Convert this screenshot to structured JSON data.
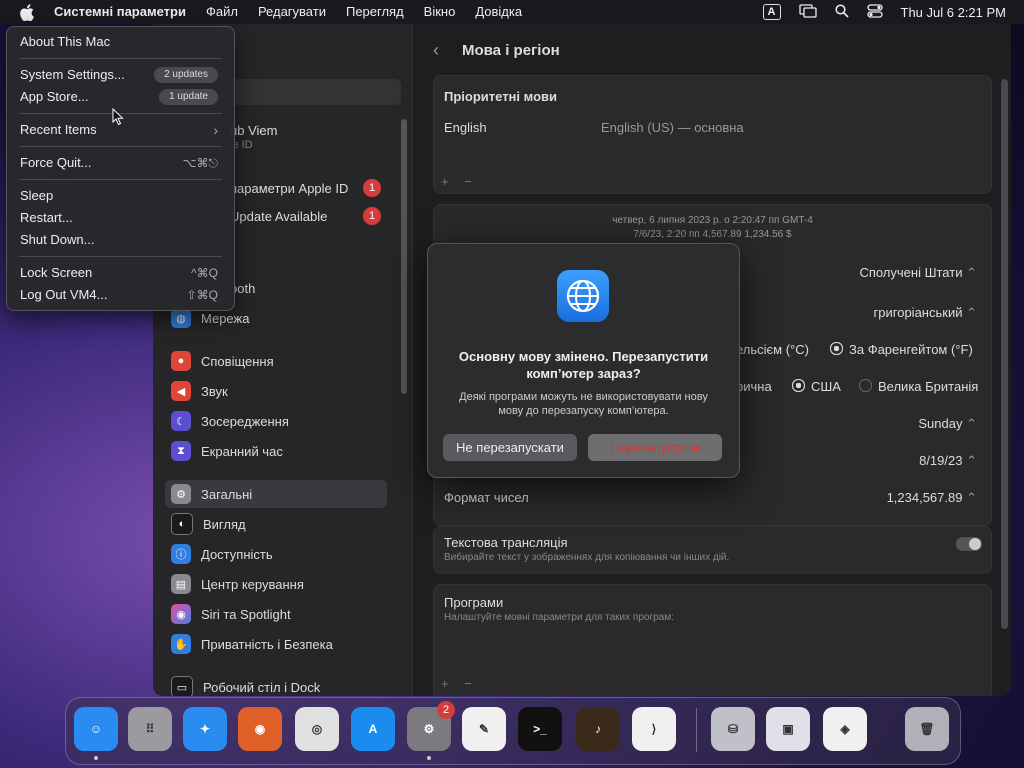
{
  "menubar": {
    "app_name": "Системні параметри",
    "menus": [
      "Файл",
      "Редагувати",
      "Перегляд",
      "Вікно",
      "Довідка"
    ],
    "input_badge": "A",
    "clock": "Thu Jul 6  2:21 PM"
  },
  "apple_menu": {
    "about": "About This Mac",
    "system_settings": "System Settings...",
    "system_settings_badge": "2 updates",
    "app_store": "App Store...",
    "app_store_badge": "1 update",
    "recent_items": "Recent Items",
    "force_quit": "Force Quit...",
    "force_quit_shortcut": "⌥⌘⎋",
    "sleep": "Sleep",
    "restart": "Restart...",
    "shut_down": "Shut Down...",
    "lock_screen": "Lock Screen",
    "lock_screen_shortcut": "^⌘Q",
    "log_out": "Log Out VM4...",
    "log_out_shortcut": "⇧⌘Q"
  },
  "sidebar": {
    "profile_name_partial": "ub Viem",
    "profile_sub_partial": "le ID",
    "apple_id_partial": "параметри Apple ID",
    "apple_id_badge": "1",
    "update_partial": "Update Available",
    "update_badge": "1",
    "bluetooth_partial": "ooth",
    "items": [
      {
        "label": "Мережа",
        "color": "#2f7ee0"
      },
      {
        "label": "Сповіщення",
        "color": "#e0453a"
      },
      {
        "label": "Звук",
        "color": "#e0453a"
      },
      {
        "label": "Зосередження",
        "color": "#5b4fd0"
      },
      {
        "label": "Екранний час",
        "color": "#5b4fd0"
      },
      {
        "label": "Загальні",
        "color": "#8a8a8e"
      },
      {
        "label": "Вигляд",
        "color": "#1a1a1a"
      },
      {
        "label": "Доступність",
        "color": "#2f7ee0"
      },
      {
        "label": "Центр керування",
        "color": "#8a8a8e"
      },
      {
        "label": "Siri та Spotlight",
        "color": "#b04fd0"
      },
      {
        "label": "Приватність і Безпека",
        "color": "#2f7ee0"
      },
      {
        "label": "Робочий стіл і Dock",
        "color": "#1a1a1a"
      }
    ]
  },
  "main": {
    "title": "Мова і регіон",
    "preferred_title": "Пріоритетні мови",
    "lang_name": "English",
    "lang_detail": "English (US) — основна",
    "plus": "+",
    "minus": "−",
    "preview_line1": "четвер, 6 липня 2023 р. о 2:20:47 пп GMT-4",
    "preview_line2": "7/6/23, 2:20 пп      4,567.89      1,234.56 $",
    "region_value": "Сполучені Штати",
    "calendar_value": "григоріанський",
    "temp_partial": "ельсієм (°C)",
    "temp_fahrenheit": "За Фаренгейтом (°F)",
    "measure_partial": "рична",
    "measure_usa": "США",
    "measure_uk": "Велика Британія",
    "first_day_value": "Sunday",
    "date_format_value": "8/19/23",
    "number_format_label": "Формат чисел",
    "number_format_value": "1,234,567.89",
    "live_text_title": "Текстова трансляція",
    "live_text_sub": "Вибирайте текст у зображеннях для копіювання чи інших дій.",
    "apps_title": "Програми",
    "apps_sub": "Налаштуйте мовні параметри для таких програм:"
  },
  "dialog": {
    "title": "Основну мову змінено. Перезапустити комп’ютер зараз?",
    "message": "Деякі програми можуть не використовувати нову мову до перезапуску комп’ютера.",
    "cancel": "Не перезапускати",
    "confirm": "Перезапустити"
  },
  "dock": {
    "settings_badge": "2",
    "apps": [
      {
        "name": "finder-icon",
        "color": "#2a8cf0",
        "glyph": "☺"
      },
      {
        "name": "launchpad-icon",
        "color": "#9a9aa0",
        "glyph": "⠿"
      },
      {
        "name": "safari-icon",
        "color": "#2a8cf0",
        "glyph": "✦"
      },
      {
        "name": "firefox-icon",
        "color": "#e0602a",
        "glyph": "◉"
      },
      {
        "name": "chrome-icon",
        "color": "#e0e0e0",
        "glyph": "◎"
      },
      {
        "name": "app-store-icon",
        "color": "#1a8cf0",
        "glyph": "A"
      },
      {
        "name": "system-settings-icon",
        "color": "#7a7a80",
        "glyph": "⚙"
      },
      {
        "name": "textedit-icon",
        "color": "#f0f0f0",
        "glyph": "✎"
      },
      {
        "name": "terminal-icon",
        "color": "#111111",
        "glyph": ">_"
      },
      {
        "name": "garageband-icon",
        "color": "#3a2a1a",
        "glyph": "♪"
      },
      {
        "name": "vscode-icon",
        "color": "#f0f0f0",
        "glyph": "⟩"
      },
      {
        "name": "disk-utility-icon",
        "color": "#c0c0c8",
        "glyph": "⛁"
      },
      {
        "name": "parallels-icon",
        "color": "#e0e0e8",
        "glyph": "▣"
      },
      {
        "name": "visual-studio-icon",
        "color": "#f0f0f0",
        "glyph": "◈"
      },
      {
        "name": "trash-icon",
        "color": "#b0b0b8",
        "glyph": "🗑"
      }
    ]
  }
}
